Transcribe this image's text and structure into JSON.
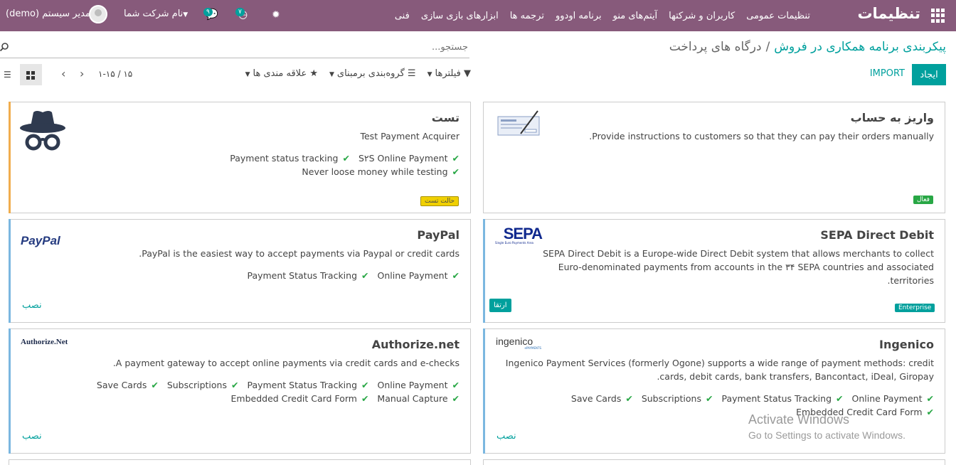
{
  "topbar": {
    "brand": "تنظیمات",
    "menu": [
      "تنظیمات عمومی",
      "کاربران و شرکتها",
      "آیتم‌های منو",
      "برنامه اودوو",
      "ترجمه ها",
      "ابزارهای بازی سازی",
      "فنی"
    ],
    "clock_badge": "۷",
    "chat_badge": "۹",
    "company": "نام شرکت شما",
    "user": "مدیر سیستم (demo)",
    "colors": {
      "bar": "#875a7b",
      "accent": "#00a09d"
    }
  },
  "breadcrumb": {
    "parent": "پیکربندی برنامه همکاری در فروش",
    "current": "درگاه های پرداخت"
  },
  "search": {
    "placeholder": "جستجو..."
  },
  "toolbar": {
    "create": "ایجاد",
    "import": "IMPORT",
    "filters": "فیلترها",
    "group_by": "گروه‌بندی برمبنای",
    "favorites": "علاقه مندی ها",
    "pager": "۱-۱۵ / ۱۵"
  },
  "cards": [
    {
      "title": "واریز به حساب",
      "desc": "Provide instructions to customers so that they can pay their orders manually.",
      "features": [],
      "tag": "فعال",
      "status_color": "#28a745"
    },
    {
      "title": "تست",
      "desc": "Test Payment Acquirer",
      "features": [
        "S۲S Online Payment",
        "Payment status tracking",
        "Never loose money while testing"
      ],
      "tag": "حالت تست",
      "status_color": "#f0ad4e"
    },
    {
      "title": "SEPA Direct Debit",
      "desc": "SEPA Direct Debit is a Europe-wide Direct Debit system that allows merchants to collect Euro-denominated payments from accounts in the ۳۴ SEPA countries and associated territories.",
      "features": [],
      "tag": "Enterprise",
      "upgrade": "ارتقا",
      "logo_text": "SEPA",
      "logo_sub": "Single Euro Payments Area"
    },
    {
      "title": "PayPal",
      "desc": "PayPal is the easiest way to accept payments via Paypal or credit cards.",
      "features": [
        "Online Payment",
        "Payment Status Tracking"
      ],
      "install": "نصب",
      "logo_text": "PayPal"
    },
    {
      "title": "Ingenico",
      "desc": "Ingenico Payment Services (formerly Ogone) supports a wide range of payment methods: credit cards, debit cards, bank transfers, Bancontact, iDeal, Giropay.",
      "features": [
        "Online Payment",
        "Payment Status Tracking",
        "Subscriptions",
        "Save Cards",
        "Embedded Credit Card Form"
      ],
      "install": "نصب",
      "logo_text": "ingenico",
      "logo_sub": "ePAYMENTS"
    },
    {
      "title": "Authorize.net",
      "desc": "A payment gateway to accept online payments via credit cards and e-checks.",
      "features": [
        "Online Payment",
        "Payment Status Tracking",
        "Subscriptions",
        "Save Cards",
        "Manual Capture",
        "Embedded Credit Card Form"
      ],
      "install": "نصب",
      "logo_text": "Authorize.Net"
    }
  ],
  "watermark": {
    "line1": "Activate Windows",
    "line2": "Go to Settings to activate Windows."
  }
}
